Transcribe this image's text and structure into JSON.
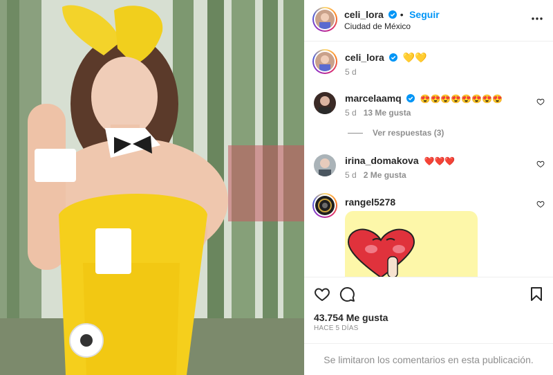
{
  "post": {
    "author": {
      "username": "celi_lora",
      "verified": true,
      "follow_label": "Seguir",
      "location": "Ciudad de México"
    },
    "caption": {
      "username": "celi_lora",
      "text": "💛💛",
      "age": "5 d"
    },
    "comments": [
      {
        "username": "marcelaamq",
        "verified": true,
        "text": "😍😍😍😍😍😍😍😍",
        "age": "5 d",
        "likes": "13 Me gusta",
        "view_replies": "Ver respuestas (3)"
      },
      {
        "username": "irina_domakova",
        "verified": false,
        "text": "❤️❤️❤️",
        "age": "5 d",
        "likes": "2 Me gusta"
      },
      {
        "username": "rangel5278",
        "verified": false,
        "text": "",
        "has_sticker": true
      }
    ],
    "actions": {
      "like_icon": "heart-outline-icon",
      "comment_icon": "comment-bubble-icon",
      "save_icon": "bookmark-icon"
    },
    "likes_count": "43.754 Me gusta",
    "posted_ago": "HACE 5 DÍAS",
    "comments_limited_text": "Se limitaron los comentarios en esta publicación.",
    "colors": {
      "accent": "#0095f6",
      "text": "#262626",
      "muted": "#8e8e8e",
      "divider": "#efefef"
    }
  }
}
